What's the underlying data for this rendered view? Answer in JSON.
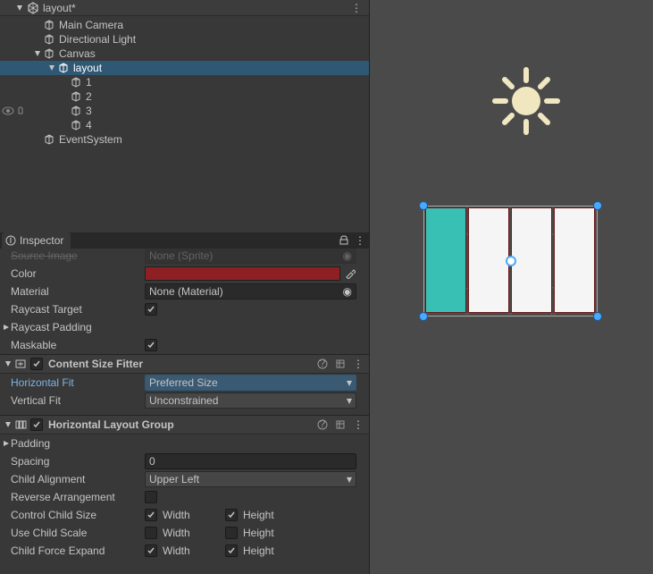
{
  "hierarchy": {
    "root": "layout*",
    "nodes": {
      "n0": "Main Camera",
      "n1": "Directional Light",
      "n2": "Canvas",
      "n3": "layout",
      "n4": "1",
      "n5": "2",
      "n6": "3",
      "n7": "4",
      "n8": "EventSystem"
    }
  },
  "inspector": {
    "tab": "Inspector",
    "image": {
      "source_label": "Source Image",
      "source_value": "None (Sprite)",
      "color_label": "Color",
      "color_hex": "#8c2022",
      "material_label": "Material",
      "material_value": "None (Material)",
      "raycast_label": "Raycast Target",
      "raycast_padding_label": "Raycast Padding",
      "maskable_label": "Maskable"
    },
    "csf": {
      "title": "Content Size Fitter",
      "hfit_label": "Horizontal Fit",
      "hfit_value": "Preferred Size",
      "vfit_label": "Vertical Fit",
      "vfit_value": "Unconstrained"
    },
    "hlg": {
      "title": "Horizontal Layout Group",
      "padding_label": "Padding",
      "spacing_label": "Spacing",
      "spacing_value": "0",
      "align_label": "Child Alignment",
      "align_value": "Upper Left",
      "reverse_label": "Reverse Arrangement",
      "ctrlsize_label": "Control Child Size",
      "usescale_label": "Use Child Scale",
      "forceexp_label": "Child Force Expand",
      "width": "Width",
      "height": "Height"
    }
  }
}
